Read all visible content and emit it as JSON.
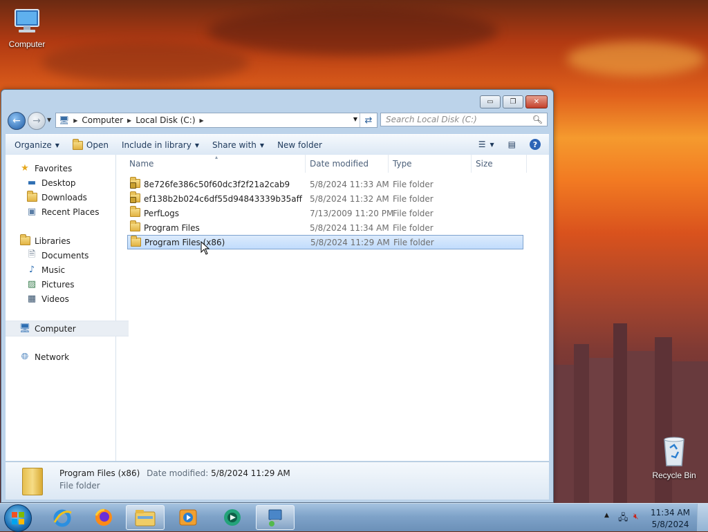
{
  "desktop": {
    "computer_label": "Computer",
    "recycle_label": "Recycle Bin"
  },
  "window": {
    "controls": {
      "minimize": "▭",
      "maximize": "❐",
      "close": "✕"
    },
    "address": {
      "segments": [
        "Computer",
        "Local Disk (C:)"
      ],
      "search_placeholder": "Search Local Disk (C:)"
    },
    "toolbar": {
      "organize": "Organize",
      "open": "Open",
      "include_in_library": "Include in library",
      "share_with": "Share with",
      "new_folder": "New folder"
    },
    "nav": {
      "favorites": "Favorites",
      "desktop": "Desktop",
      "downloads": "Downloads",
      "recent_places": "Recent Places",
      "libraries": "Libraries",
      "documents": "Documents",
      "music": "Music",
      "pictures": "Pictures",
      "videos": "Videos",
      "computer": "Computer",
      "network": "Network"
    },
    "columns": {
      "name": "Name",
      "date": "Date modified",
      "type": "Type",
      "size": "Size"
    },
    "files": [
      {
        "name": "8e726fe386c50f60dc3f2f21a2cab9",
        "date": "5/8/2024 11:33 AM",
        "type": "File folder",
        "locked": true
      },
      {
        "name": "ef138b2b024c6df55d94843339b35aff",
        "date": "5/8/2024 11:32 AM",
        "type": "File folder",
        "locked": true
      },
      {
        "name": "PerfLogs",
        "date": "7/13/2009 11:20 PM",
        "type": "File folder",
        "locked": false
      },
      {
        "name": "Program Files",
        "date": "5/8/2024 11:34 AM",
        "type": "File folder",
        "locked": false
      },
      {
        "name": "Program Files (x86)",
        "date": "5/8/2024 11:29 AM",
        "type": "File folder",
        "locked": false,
        "selected": true
      }
    ],
    "details": {
      "name": "Program Files (x86)",
      "date_label": "Date modified:",
      "date_value": "5/8/2024 11:29 AM",
      "type": "File folder"
    }
  },
  "taskbar": {
    "time": "11:34 AM",
    "date": "5/8/2024"
  }
}
